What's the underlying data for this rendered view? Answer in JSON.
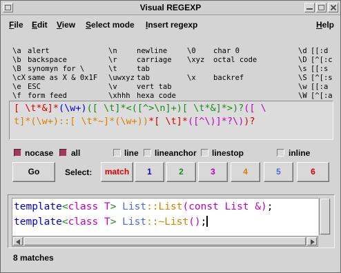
{
  "window": {
    "title": "Visual REGEXP"
  },
  "menus": [
    {
      "label": "File",
      "ul": "F",
      "rest": "ile"
    },
    {
      "label": "Edit",
      "ul": "E",
      "rest": "dit"
    },
    {
      "label": "View",
      "ul": "V",
      "rest": "iew"
    },
    {
      "label": "Select mode",
      "ul": "S",
      "rest": "elect mode"
    },
    {
      "label": "Insert regexp",
      "ul": "I",
      "rest": "nsert regexp"
    },
    {
      "label": "Help",
      "ul": "H",
      "rest": "elp"
    }
  ],
  "reference": {
    "col1": [
      {
        "key": "\\a",
        "desc": "alert"
      },
      {
        "key": "\\b",
        "desc": "backspace"
      },
      {
        "key": "\\B",
        "desc": "synomyn for \\"
      },
      {
        "key": "\\cX",
        "desc": "same as X & 0x1F"
      },
      {
        "key": "\\e",
        "desc": "ESC"
      },
      {
        "key": "\\f",
        "desc": "form feed"
      }
    ],
    "col2": [
      {
        "key": "\\n",
        "desc": "newline"
      },
      {
        "key": "\\r",
        "desc": "carriage"
      },
      {
        "key": "\\t",
        "desc": "tab"
      },
      {
        "key": "\\uwxyz",
        "desc": "tab"
      },
      {
        "key": "\\v",
        "desc": "vert tab"
      },
      {
        "key": "\\xhhh",
        "desc": "hexa code"
      }
    ],
    "col3": [
      {
        "key": "\\0",
        "desc": "char 0"
      },
      {
        "key": "\\xyz",
        "desc": "octal code"
      },
      {
        "key": "",
        "desc": ""
      },
      {
        "key": "\\x",
        "desc": "backref"
      },
      {
        "key": "",
        "desc": ""
      },
      {
        "key": "",
        "desc": ""
      }
    ],
    "col4": [
      {
        "key": "\\d",
        "desc": "[[:d"
      },
      {
        "key": "\\D",
        "desc": "[^[:c"
      },
      {
        "key": "\\s",
        "desc": "[[:s"
      },
      {
        "key": "\\S",
        "desc": "[^[:s"
      },
      {
        "key": "\\w",
        "desc": "[[:a"
      },
      {
        "key": "\\W",
        "desc": "[^[:a"
      }
    ]
  },
  "regex": {
    "line1": [
      {
        "t": "[ \\t*&]*",
        "c": "#d40000"
      },
      {
        "t": "(\\w+)",
        "c": "#0000d0"
      },
      {
        "t": "([ \\t]*<([^>\\n]+)[ \\t*&]*>)?",
        "c": "#1a8a1a"
      },
      {
        "t": "([ \\",
        "c": "#c000c0"
      }
    ],
    "line2": [
      {
        "t": "t]*(\\w+)::[ \\t*~]*(\\w+))",
        "c": "#d48000"
      },
      {
        "t": "*[ \\t]*",
        "c": "#d40000"
      },
      {
        "t": "([^\\)]*?\\)",
        "c": "#c000c0"
      },
      {
        "t": ")?",
        "c": "#d40000"
      }
    ]
  },
  "options": {
    "nocase": {
      "label": "nocase",
      "checked": true
    },
    "all": {
      "label": "all",
      "checked": true
    },
    "line": {
      "label": "line",
      "checked": false
    },
    "lineanchor": {
      "label": "lineanchor",
      "checked": false
    },
    "linestop": {
      "label": "linestop",
      "checked": false
    },
    "inline": {
      "label": "inline",
      "checked": false
    }
  },
  "buttons": {
    "go": "Go",
    "select_label": "Select:",
    "match": {
      "label": "match",
      "color": "#d40000"
    },
    "b1": {
      "label": "1",
      "color": "#0000d0"
    },
    "b2": {
      "label": "2",
      "color": "#1a8a1a"
    },
    "b3": {
      "label": "3",
      "color": "#c000c0"
    },
    "b4": {
      "label": "4",
      "color": "#d48000"
    },
    "b5": {
      "label": "5",
      "color": "#4a6ad8"
    },
    "b6": {
      "label": "6",
      "color": "#d40000"
    }
  },
  "results": {
    "line1": [
      {
        "t": "template",
        "c": "#0000d0"
      },
      {
        "t": "<",
        "c": "#1a8a1a"
      },
      {
        "t": "class T",
        "c": "#c000c0"
      },
      {
        "t": "> ",
        "c": "#1a8a1a"
      },
      {
        "t": "List",
        "c": "#4a6ad8"
      },
      {
        "t": "::List",
        "c": "#d48000"
      },
      {
        "t": "(const List &)",
        "c": "#c000c0"
      },
      {
        "t": ";",
        "c": "#000000"
      }
    ],
    "line2": [
      {
        "t": "template",
        "c": "#0000d0"
      },
      {
        "t": "<",
        "c": "#1a8a1a"
      },
      {
        "t": "class T",
        "c": "#c000c0"
      },
      {
        "t": "> ",
        "c": "#1a8a1a"
      },
      {
        "t": "List",
        "c": "#4a6ad8"
      },
      {
        "t": "::~List",
        "c": "#d48000"
      },
      {
        "t": "()",
        "c": "#c000c0"
      },
      {
        "t": ";",
        "c": "#000000"
      }
    ]
  },
  "status": "8 matches"
}
